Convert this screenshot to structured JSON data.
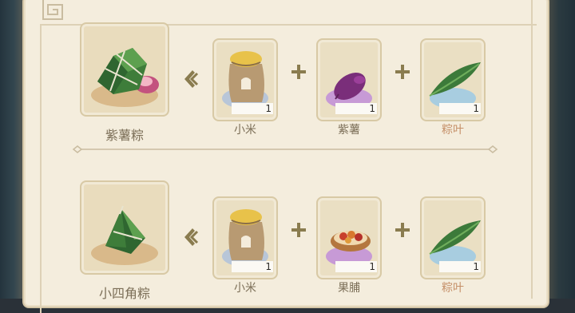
{
  "colors": {
    "panel_bg": "#f4eddd",
    "card_bg": "#eadfc3",
    "label_text": "#7c6f58",
    "accent_olive": "#8a7c4f",
    "plate_rice": "#b8c6d8",
    "plate_potato": "#c79ad6",
    "plate_leaf": "#a8cde0",
    "plate_fruit": "#c79ad6"
  },
  "recipes": [
    {
      "result": {
        "name": "紫薯粽",
        "icon": "purple-potato-zongzi-icon"
      },
      "ingredients": [
        {
          "name": "小米",
          "icon": "millet-sack-icon",
          "qty": "1"
        },
        {
          "name": "紫薯",
          "icon": "purple-sweet-potato-icon",
          "qty": "1"
        },
        {
          "name": "粽叶",
          "icon": "bamboo-leaf-icon",
          "qty": "1"
        }
      ]
    },
    {
      "result": {
        "name": "小四角粽",
        "icon": "four-corner-zongzi-icon"
      },
      "ingredients": [
        {
          "name": "小米",
          "icon": "millet-sack-icon",
          "qty": "1"
        },
        {
          "name": "果脯",
          "icon": "dried-fruit-bowl-icon",
          "qty": "1"
        },
        {
          "name": "粽叶",
          "icon": "bamboo-leaf-icon",
          "qty": "1"
        }
      ]
    }
  ]
}
